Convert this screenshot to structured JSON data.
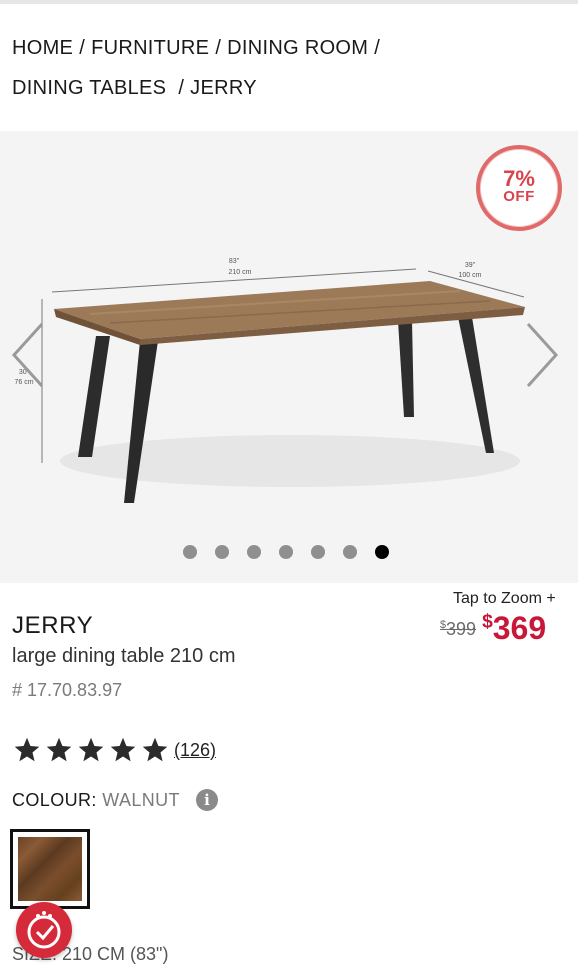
{
  "breadcrumb": {
    "items": [
      "HOME",
      "FURNITURE",
      "DINING ROOM",
      "DINING TABLES",
      "JERRY"
    ],
    "separator": "/"
  },
  "gallery": {
    "image_alt": "dining table",
    "dimension_labels": {
      "length_in": "83\"",
      "length_cm": "210 cm",
      "depth_in": "39\"",
      "depth_cm": "100 cm",
      "height_in": "30\"",
      "height_cm": "76 cm"
    },
    "badge": {
      "percent": "7%",
      "label": "OFF",
      "color": "#e06a6a"
    },
    "slide_count": 7,
    "active_slide": 7,
    "prev_icon": "chevron-left-icon",
    "next_icon": "chevron-right-icon"
  },
  "zoom": {
    "label": "Tap to Zoom",
    "icon": "+"
  },
  "price": {
    "old_symbol": "$",
    "old_value": "399",
    "new_symbol": "$",
    "new_value": "369",
    "accent": "#c9173a"
  },
  "product": {
    "name": "JERRY",
    "description": "large dining table 210 cm",
    "sku": "# 17.70.83.97"
  },
  "rating": {
    "stars": 5,
    "max": 5,
    "reviews": "(126)"
  },
  "colour": {
    "label": "COLOUR:",
    "value": "WALNUT",
    "info_icon": "i"
  },
  "size": {
    "text": "SIZE: 210 CM (83\")"
  }
}
